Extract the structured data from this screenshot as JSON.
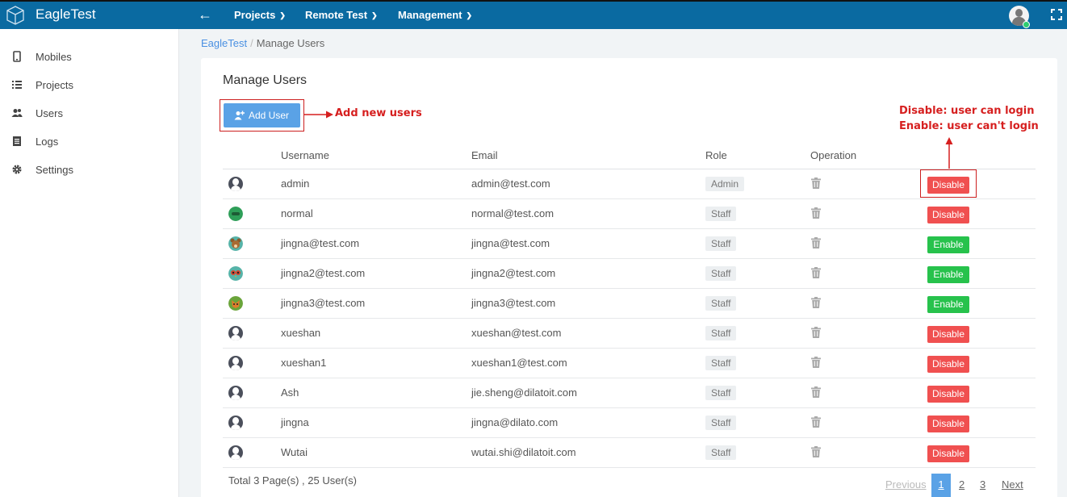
{
  "topbar": {
    "brand": "EagleTest",
    "nav": [
      {
        "label": "Projects"
      },
      {
        "label": "Remote Test"
      },
      {
        "label": "Management"
      }
    ],
    "colors": {
      "bar": "#0a6aa1"
    }
  },
  "sidebar": {
    "items": [
      {
        "label": "Mobiles",
        "icon": "mobile-icon"
      },
      {
        "label": "Projects",
        "icon": "list-icon"
      },
      {
        "label": "Users",
        "icon": "users-icon"
      },
      {
        "label": "Logs",
        "icon": "log-icon"
      },
      {
        "label": "Settings",
        "icon": "gear-icon"
      }
    ]
  },
  "breadcrumb": {
    "root": "EagleTest",
    "current": "Manage Users"
  },
  "page": {
    "title": "Manage Users",
    "add_label": "Add User"
  },
  "annotations": {
    "add": "Add new users",
    "toggle_line1": "Disable: user can login",
    "toggle_line2": "Enable: user can't login",
    "color": "#d61f1f"
  },
  "table": {
    "headers": {
      "username": "Username",
      "email": "Email",
      "role": "Role",
      "operation": "Operation"
    },
    "rows": [
      {
        "username": "admin",
        "email": "admin@test.com",
        "role": "Admin",
        "action": "Disable",
        "avatar": "default"
      },
      {
        "username": "normal",
        "email": "normal@test.com",
        "role": "Staff",
        "action": "Disable",
        "avatar": "green-face"
      },
      {
        "username": "jingna@test.com",
        "email": "jingna@test.com",
        "role": "Staff",
        "action": "Enable",
        "avatar": "bear"
      },
      {
        "username": "jingna2@test.com",
        "email": "jingna2@test.com",
        "role": "Staff",
        "action": "Enable",
        "avatar": "owl"
      },
      {
        "username": "jingna3@test.com",
        "email": "jingna3@test.com",
        "role": "Staff",
        "action": "Enable",
        "avatar": "fox"
      },
      {
        "username": "xueshan",
        "email": "xueshan@test.com",
        "role": "Staff",
        "action": "Disable",
        "avatar": "default"
      },
      {
        "username": "xueshan1",
        "email": "xueshan1@test.com",
        "role": "Staff",
        "action": "Disable",
        "avatar": "default"
      },
      {
        "username": "Ash",
        "email": "jie.sheng@dilatoit.com",
        "role": "Staff",
        "action": "Disable",
        "avatar": "default"
      },
      {
        "username": "jingna",
        "email": "jingna@dilato.com",
        "role": "Staff",
        "action": "Disable",
        "avatar": "default"
      },
      {
        "username": "Wutai",
        "email": "wutai.shi@dilatoit.com",
        "role": "Staff",
        "action": "Disable",
        "avatar": "default"
      }
    ]
  },
  "footer": {
    "total": "Total 3 Page(s) ,  25 User(s)"
  },
  "pagination": {
    "previous": "Previous",
    "pages": [
      "1",
      "2",
      "3"
    ],
    "next": "Next",
    "current": "1"
  },
  "colors": {
    "disable": "#f05050",
    "enable": "#27c24c",
    "primary": "#5aa2e6"
  }
}
